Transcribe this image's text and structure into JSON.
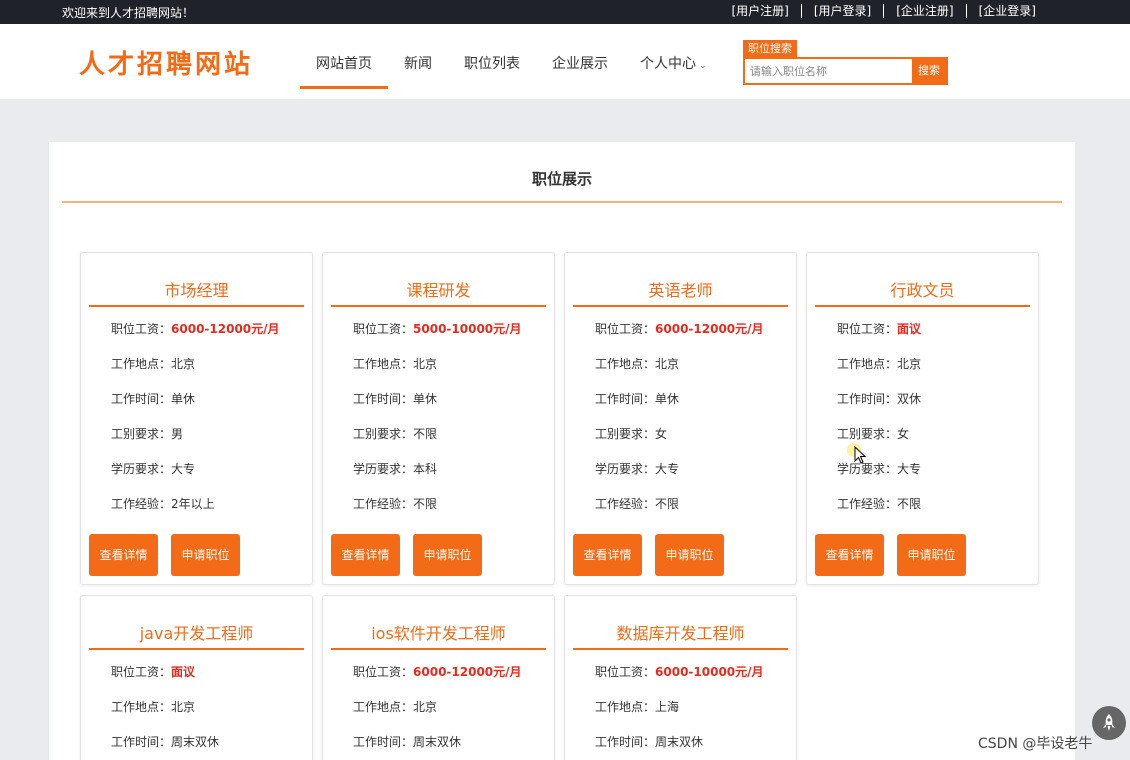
{
  "topbar": {
    "welcome": "欢迎来到人才招聘网站！",
    "links": [
      "[用户注册]",
      "[用户登录]",
      "[企业注册]",
      "[企业登录]"
    ]
  },
  "header": {
    "logo": "人才招聘网站",
    "nav": [
      {
        "label": "网站首页",
        "active": true
      },
      {
        "label": "新闻"
      },
      {
        "label": "职位列表"
      },
      {
        "label": "企业展示"
      },
      {
        "label": "个人中心"
      }
    ],
    "search": {
      "tag": "职位搜索",
      "placeholder": "请输入职位名称",
      "button": "搜索"
    }
  },
  "main": {
    "title": "职位展示"
  },
  "labels": {
    "salary": "职位工资：",
    "location": "工作地点：",
    "time": "工作时间：",
    "gender": "工别要求：",
    "education": "学历要求：",
    "experience": "工作经验：",
    "detail_btn": "查看详情",
    "apply_btn": "申请职位"
  },
  "jobs": [
    {
      "title": "市场经理",
      "salary": "6000-12000元/月",
      "location": "北京",
      "time": "单休",
      "gender": "男",
      "education": "大专",
      "experience": "2年以上"
    },
    {
      "title": "课程研发",
      "salary": "5000-10000元/月",
      "location": "北京",
      "time": "单休",
      "gender": "不限",
      "education": "本科",
      "experience": "不限"
    },
    {
      "title": "英语老师",
      "salary": "6000-12000元/月",
      "location": "北京",
      "time": "单休",
      "gender": "女",
      "education": "大专",
      "experience": "不限"
    },
    {
      "title": "行政文员",
      "salary": "面议",
      "location": "北京",
      "time": "双休",
      "gender": "女",
      "education": "大专",
      "experience": "不限"
    },
    {
      "title": "java开发工程师",
      "salary": "面议",
      "location": "北京",
      "time": "周末双休"
    },
    {
      "title": "ios软件开发工程师",
      "salary": "6000-12000元/月",
      "location": "北京",
      "time": "周末双休"
    },
    {
      "title": "数据库开发工程师",
      "salary": "6000-10000元/月",
      "location": "上海",
      "time": "周末双休"
    }
  ],
  "watermark": "CSDN @毕设老牛",
  "colors": {
    "accent": "#f36b16",
    "salary": "#e52a1f",
    "topbar": "#1f2228"
  }
}
